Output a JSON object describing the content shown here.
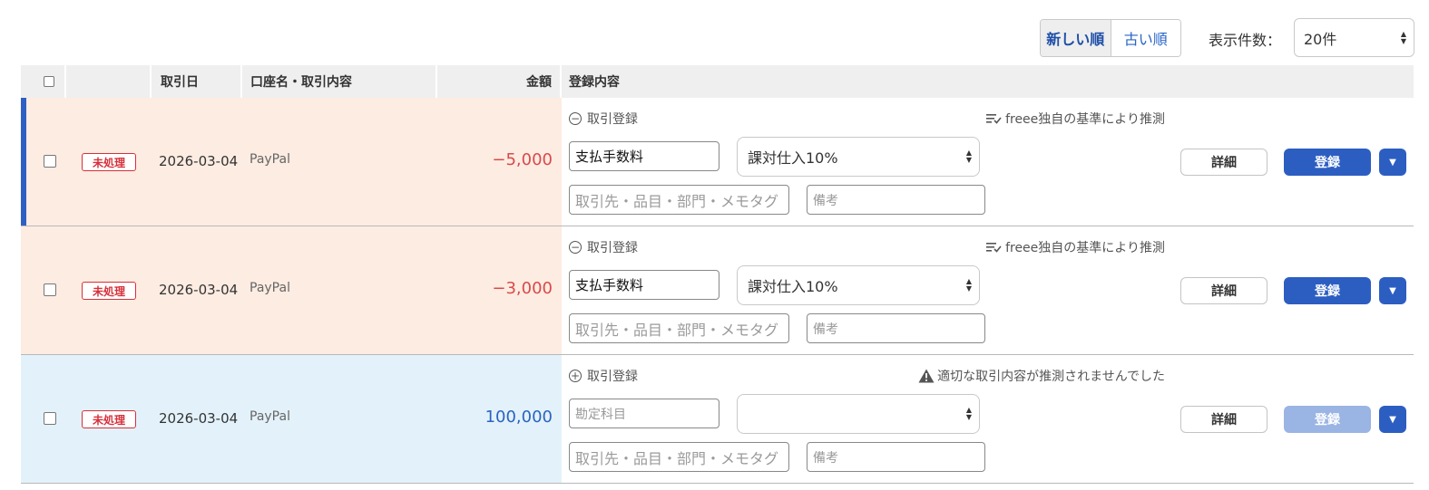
{
  "sort": {
    "newest": "新しい順",
    "oldest": "古い順"
  },
  "page_size": {
    "label": "表示件数：",
    "value": "20件"
  },
  "columns": {
    "date": "取引日",
    "account": "口座名・取引内容",
    "amount": "金額",
    "registration": "登録内容"
  },
  "rows": [
    {
      "status": "未処理",
      "date": "2026-03-04",
      "account": "PayPal",
      "amount": "−5,000",
      "reg_toggle": "取引登録",
      "hint": "freee独自の基準により推測",
      "account_item": "支払手数料",
      "tax": "課対仕入10%",
      "tags_placeholder": "取引先・品目・部門・メモタグ",
      "memo_placeholder": "備考",
      "detail": "詳細",
      "register": "登録"
    },
    {
      "status": "未処理",
      "date": "2026-03-04",
      "account": "PayPal",
      "amount": "−3,000",
      "reg_toggle": "取引登録",
      "hint": "freee独自の基準により推測",
      "account_item": "支払手数料",
      "tax": "課対仕入10%",
      "tags_placeholder": "取引先・品目・部門・メモタグ",
      "memo_placeholder": "備考",
      "detail": "詳細",
      "register": "登録"
    },
    {
      "status": "未処理",
      "date": "2026-03-04",
      "account": "PayPal",
      "amount": "100,000",
      "reg_toggle": "取引登録",
      "hint": "適切な取引内容が推測されませんでした",
      "account_placeholder": "勘定科目",
      "tax": "",
      "tags_placeholder": "取引先・品目・部門・メモタグ",
      "memo_placeholder": "備考",
      "detail": "詳細",
      "register": "登録"
    }
  ],
  "colors": {
    "brand": "#2c5ec2",
    "negative": "#d94a4a",
    "positive": "#2a63c2",
    "status": "#d62f3a",
    "expense_bg": "#fdece2",
    "income_bg": "#e3f2fa"
  },
  "icons": {
    "collapse": "minus-circle-icon",
    "expand": "plus-circle-icon",
    "guess": "list-check-icon",
    "warning": "warning-triangle-icon",
    "dropdown": "caret-down-icon"
  }
}
